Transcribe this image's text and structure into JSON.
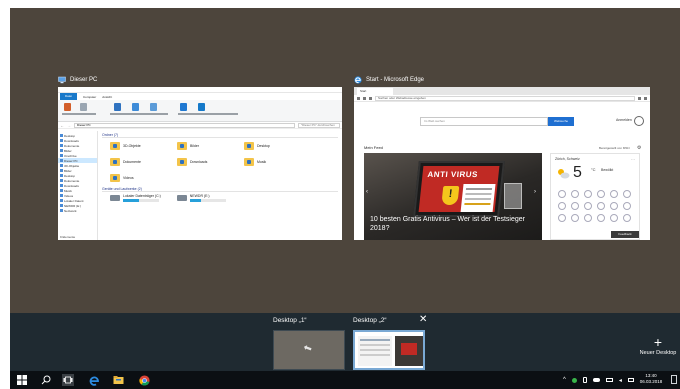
{
  "windows": [
    {
      "title": "Dieser PC",
      "icon": "computer-icon",
      "menu": [
        "Datei",
        "Computer",
        "Ansicht"
      ],
      "address": "Dieser PC",
      "search_placeholder": "\"Dieser PC\" durchsuchen",
      "nav": [
        "Desktop",
        "Downloads",
        "Dokumente",
        "Bilder",
        "OneDrive",
        "Dieser PC",
        "3D-Objekte",
        "Bilder",
        "Desktop",
        "Dokumente",
        "Downloads",
        "Musik",
        "Videos",
        "Lokaler Datent",
        "NEWDR (E:)",
        "Netzwerk"
      ],
      "folders_header": "Ordner (7)",
      "folders": [
        "3D-Objekte",
        "Bilder",
        "Desktop",
        "Dokumente",
        "Downloads",
        "Musik",
        "Videos"
      ],
      "drives_header": "Geräte und Laufwerke (2)",
      "drives": [
        {
          "name": "Lokaler Datenträger (C:)",
          "fill": 0.45
        },
        {
          "name": "NEWDR (E:)",
          "fill": 0.3
        }
      ],
      "status": "9 Elemente"
    },
    {
      "title": "Start - Microsoft Edge",
      "icon": "edge-icon",
      "tab_label": "Start",
      "url_placeholder": "Suchen oder Webadresse eingeben",
      "search_placeholder": "Im Web suchen",
      "search_button": "Websuche",
      "user_label": "Anmelden",
      "feed_title": "Mein Feed",
      "feed_meta": "Bereitgestellt von MSN",
      "news": {
        "image_text": "ANTI VIRUS",
        "headline": "10 besten Gratis Antivirus – Wer ist der Testsieger 2018?"
      },
      "weather": {
        "city": "Zürich, Schweiz",
        "temp": "5",
        "unit": "°C",
        "desc": "Bewölkt"
      },
      "feedback": "Feedback"
    }
  ],
  "desktops": [
    {
      "label": "Desktop „1“"
    },
    {
      "label": "Desktop „2“"
    }
  ],
  "new_desktop": {
    "label": "Neuer Desktop"
  },
  "taskbar": {
    "apps": [
      "windows-start-icon",
      "search-icon",
      "task-view-icon",
      "edge-icon",
      "file-explorer-icon",
      "chrome-icon"
    ],
    "time": "13:40",
    "date": "06.03.2018"
  },
  "colors": {
    "taskview_bg": "#4d453c",
    "strip_bg": "#1f2a31",
    "taskbar_bg": "#0b0f13",
    "accent": "#1f6fd1"
  }
}
